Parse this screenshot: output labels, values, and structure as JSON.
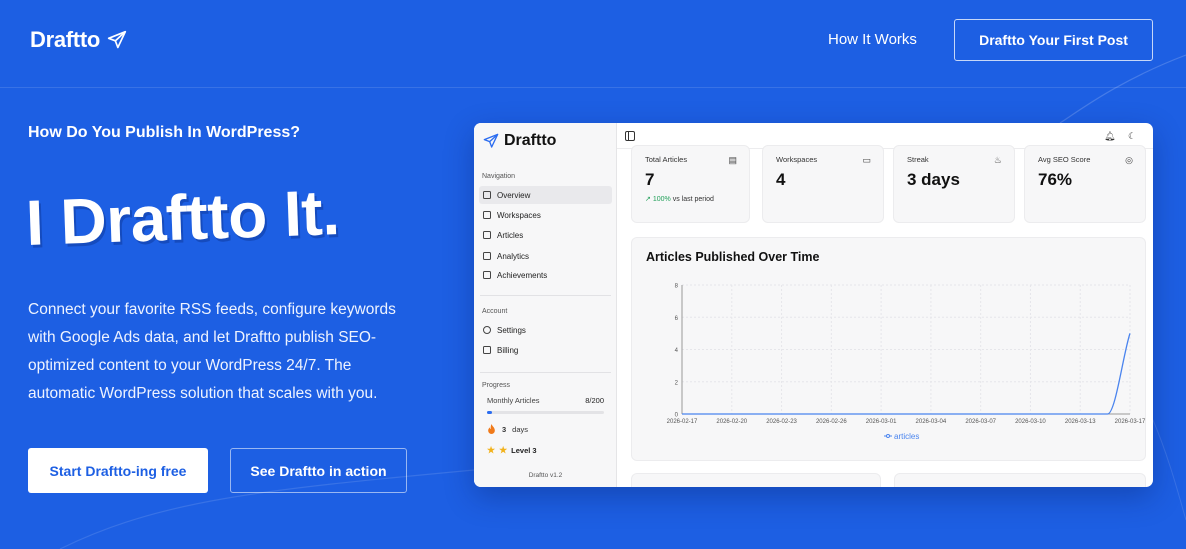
{
  "brand": {
    "name": "Draftto"
  },
  "nav": {
    "how_it_works": "How It Works",
    "cta": "Draftto Your First Post"
  },
  "hero": {
    "kicker": "How Do You Publish In WordPress?",
    "headline": "I Draftto It.",
    "description": "Connect your favorite RSS feeds, configure keywords with Google Ads data, and let Draftto publish SEO-optimized content to your WordPress 24/7. The automatic WordPress solution that scales with you.",
    "primary_button": "Start Draftto-ing free",
    "secondary_button": "See Draftto in action"
  },
  "dashboard": {
    "logo": "Draftto",
    "navigation_label": "Navigation",
    "nav_items": [
      {
        "label": "Overview",
        "icon": "grid-icon",
        "active": true
      },
      {
        "label": "Workspaces",
        "icon": "folder-icon",
        "active": false
      },
      {
        "label": "Articles",
        "icon": "document-icon",
        "active": false
      },
      {
        "label": "Analytics",
        "icon": "bar-chart-icon",
        "active": false
      },
      {
        "label": "Achievements",
        "icon": "trophy-icon",
        "active": false
      }
    ],
    "account_label": "Account",
    "account_items": [
      {
        "label": "Settings",
        "icon": "gear-icon"
      },
      {
        "label": "Billing",
        "icon": "credit-card-icon"
      }
    ],
    "progress_label": "Progress",
    "monthly_articles_label": "Monthly Articles",
    "monthly_articles_value": "8/200",
    "monthly_articles_fraction": 0.04,
    "streak_value": "3",
    "streak_unit": "days",
    "level": "Level 3",
    "version": "Draftto v1.2",
    "stats": [
      {
        "label": "Total Articles",
        "value": "7",
        "icon": "document-icon",
        "trend_value": "100%",
        "trend_text": "vs last period"
      },
      {
        "label": "Workspaces",
        "value": "4",
        "icon": "folder-icon"
      },
      {
        "label": "Streak",
        "value": "3 days",
        "icon": "flame-icon"
      },
      {
        "label": "Avg SEO Score",
        "value": "76%",
        "icon": "target-icon"
      }
    ],
    "accent_color": "#2b6cf0",
    "trend_color": "#22a05a"
  },
  "chart_data": {
    "type": "line",
    "title": "Articles Published Over Time",
    "x": [
      "2026-02-17",
      "2026-02-20",
      "2026-02-23",
      "2026-02-26",
      "2026-03-01",
      "2026-03-04",
      "2026-03-07",
      "2026-03-10",
      "2026-03-13",
      "2026-03-17"
    ],
    "ylim": [
      0,
      8
    ],
    "yticks": [
      "0",
      "2",
      "4",
      "6",
      "8"
    ],
    "series": [
      {
        "name": "articles",
        "values": [
          0,
          0,
          0,
          0,
          0,
          0,
          0,
          0,
          0,
          5
        ]
      }
    ],
    "grid": true,
    "legend": "bottom-center"
  }
}
